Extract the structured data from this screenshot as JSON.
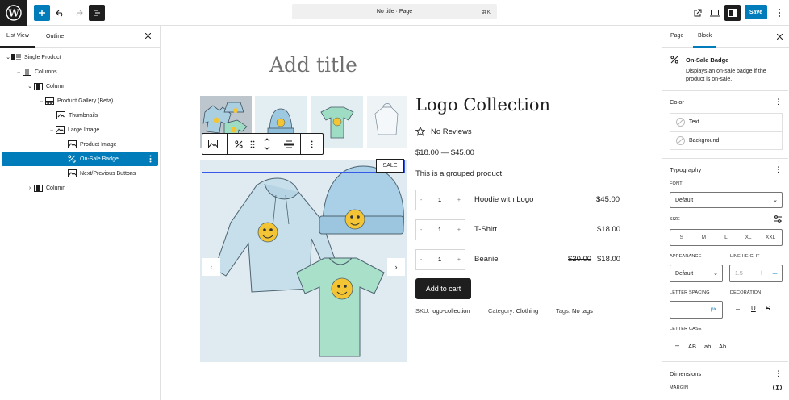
{
  "topbar": {
    "command_title": "No title · Page",
    "command_shortcut": "⌘K",
    "save_label": "Save"
  },
  "left_panel": {
    "tabs": [
      "List View",
      "Outline"
    ],
    "tree": [
      {
        "label": "Single Product"
      },
      {
        "label": "Columns"
      },
      {
        "label": "Column"
      },
      {
        "label": "Product Gallery (Beta)"
      },
      {
        "label": "Thumbnails"
      },
      {
        "label": "Large Image"
      },
      {
        "label": "Product Image"
      },
      {
        "label": "On-Sale Badge"
      },
      {
        "label": "Next/Previous Buttons"
      },
      {
        "label": "Column"
      }
    ]
  },
  "canvas": {
    "title_placeholder": "Add title",
    "sale_badge": "SALE",
    "product": {
      "title": "Logo Collection",
      "reviews": "No Reviews",
      "price": "$18.00 — $45.00",
      "description": "This is a grouped product.",
      "items": [
        {
          "qty": "1",
          "name": "Hoodie with Logo",
          "price": "$45.00",
          "old_price": ""
        },
        {
          "qty": "1",
          "name": "T-Shirt",
          "price": "$18.00",
          "old_price": ""
        },
        {
          "qty": "1",
          "name": "Beanie",
          "price": "$18.00",
          "old_price": "$20.00"
        }
      ],
      "add_to_cart": "Add to cart",
      "sku_label": "SKU:",
      "sku": "logo-collection",
      "category_label": "Category:",
      "category": "Clothing",
      "tags_label": "Tags:",
      "tags": "No tags"
    }
  },
  "right_panel": {
    "tabs": [
      "Page",
      "Block"
    ],
    "block_name": "On-Sale Badge",
    "block_description": "Displays an on-sale badge if the product is on-sale.",
    "color": {
      "heading": "Color",
      "items": [
        "Text",
        "Background"
      ]
    },
    "typography": {
      "heading": "Typography",
      "font_label": "FONT",
      "font_value": "Default",
      "size_label": "SIZE",
      "sizes": [
        "S",
        "M",
        "L",
        "XL",
        "XXL"
      ],
      "appearance_label": "APPEARANCE",
      "appearance_value": "Default",
      "line_height_label": "LINE HEIGHT",
      "line_height_placeholder": "1.5",
      "letter_spacing_label": "LETTER SPACING",
      "letter_spacing_unit": "px",
      "decoration_label": "DECORATION",
      "letter_case_label": "LETTER CASE",
      "letter_cases": [
        "AB",
        "ab",
        "Ab"
      ]
    },
    "dimensions": {
      "heading": "Dimensions",
      "margin_label": "MARGIN"
    }
  },
  "colors": {
    "accent": "#007cba",
    "dark": "#1e1e1e",
    "border": "#e0e0e0"
  }
}
